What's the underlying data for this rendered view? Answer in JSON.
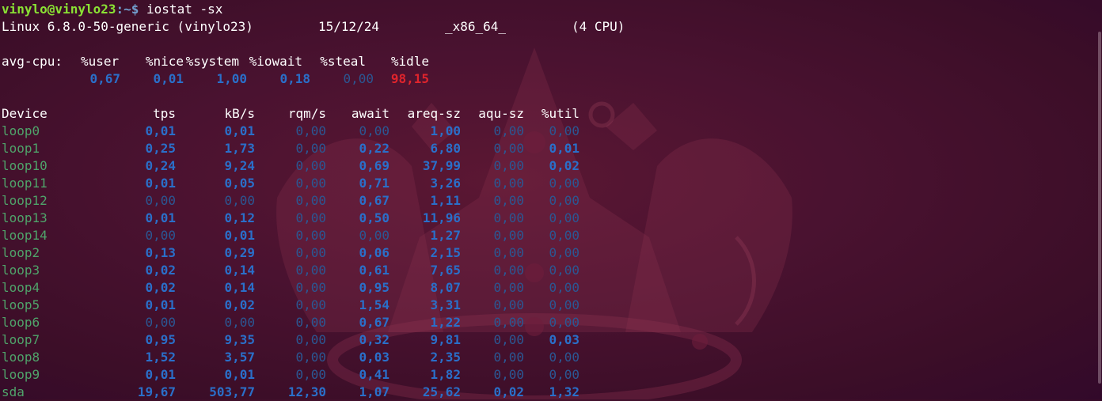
{
  "window": {
    "prompt_user": "vinylo@vinylo23",
    "prompt_path": ":~$ ",
    "command": "iostat -sx"
  },
  "sysinfo": {
    "kernel": "Linux 6.8.0-50-generic (vinylo23)",
    "date": "15/12/24",
    "arch": "_x86_64_",
    "cpus": "(4 CPU)"
  },
  "cpu": {
    "label": "avg-cpu:",
    "headers": [
      "%user",
      "%nice",
      "%system",
      "%iowait",
      "%steal",
      "%idle"
    ],
    "values": [
      "0,67",
      "0,01",
      "1,00",
      "0,18",
      "0,00",
      "98,15"
    ]
  },
  "devices": {
    "headers": [
      "Device",
      "tps",
      "kB/s",
      "rqm/s",
      "await",
      "areq-sz",
      "aqu-sz",
      "%util"
    ],
    "rows": [
      [
        "loop0",
        "0,01",
        "0,01",
        "0,00",
        "0,00",
        "1,00",
        "0,00",
        "0,00"
      ],
      [
        "loop1",
        "0,25",
        "1,73",
        "0,00",
        "0,22",
        "6,80",
        "0,00",
        "0,01"
      ],
      [
        "loop10",
        "0,24",
        "9,24",
        "0,00",
        "0,69",
        "37,99",
        "0,00",
        "0,02"
      ],
      [
        "loop11",
        "0,01",
        "0,05",
        "0,00",
        "0,71",
        "3,26",
        "0,00",
        "0,00"
      ],
      [
        "loop12",
        "0,00",
        "0,00",
        "0,00",
        "0,67",
        "1,11",
        "0,00",
        "0,00"
      ],
      [
        "loop13",
        "0,01",
        "0,12",
        "0,00",
        "0,50",
        "11,96",
        "0,00",
        "0,00"
      ],
      [
        "loop14",
        "0,00",
        "0,01",
        "0,00",
        "0,00",
        "1,27",
        "0,00",
        "0,00"
      ],
      [
        "loop2",
        "0,13",
        "0,29",
        "0,00",
        "0,06",
        "2,15",
        "0,00",
        "0,00"
      ],
      [
        "loop3",
        "0,02",
        "0,14",
        "0,00",
        "0,61",
        "7,65",
        "0,00",
        "0,00"
      ],
      [
        "loop4",
        "0,02",
        "0,14",
        "0,00",
        "0,95",
        "8,07",
        "0,00",
        "0,00"
      ],
      [
        "loop5",
        "0,01",
        "0,02",
        "0,00",
        "1,54",
        "3,31",
        "0,00",
        "0,00"
      ],
      [
        "loop6",
        "0,00",
        "0,00",
        "0,00",
        "0,67",
        "1,22",
        "0,00",
        "0,00"
      ],
      [
        "loop7",
        "0,95",
        "9,35",
        "0,00",
        "0,32",
        "9,81",
        "0,00",
        "0,03"
      ],
      [
        "loop8",
        "1,52",
        "3,57",
        "0,00",
        "0,03",
        "2,35",
        "0,00",
        "0,00"
      ],
      [
        "loop9",
        "0,01",
        "0,01",
        "0,00",
        "0,41",
        "1,82",
        "0,00",
        "0,00"
      ],
      [
        "sda",
        "19,67",
        "503,77",
        "12,30",
        "1,07",
        "25,62",
        "0,02",
        "1,32"
      ]
    ]
  },
  "colors": {
    "background": "#4a1230",
    "prompt_user": "#8ae234",
    "prompt_path": "#729fcf",
    "device_name": "#4fa36a",
    "value_nonzero": "#2a6fc9",
    "value_zero": "#2b5793",
    "idle_value": "#e0242c"
  }
}
